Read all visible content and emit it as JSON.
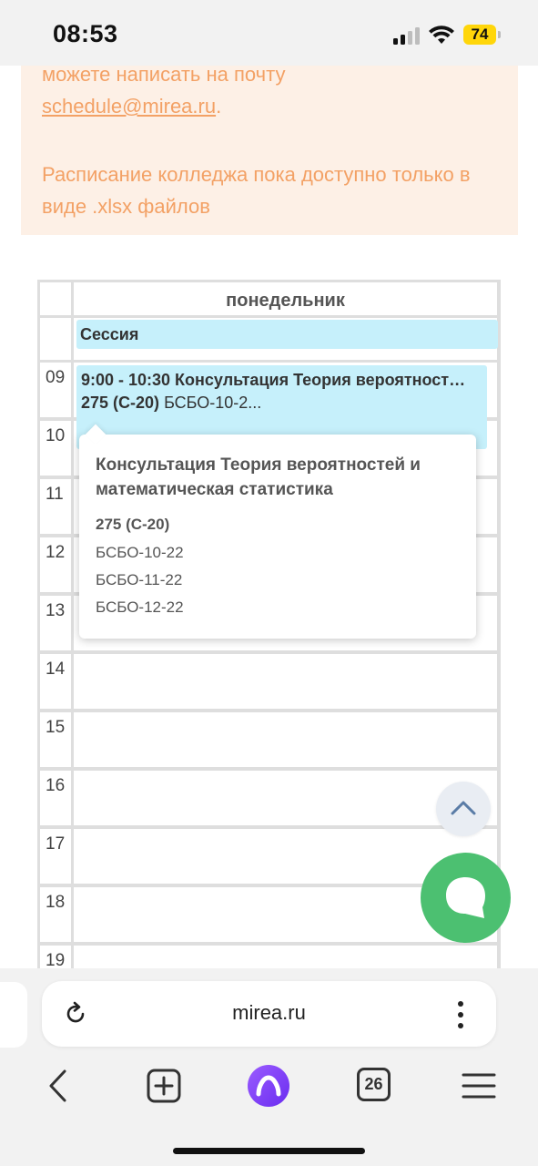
{
  "status_bar": {
    "time": "08:53",
    "battery": "74"
  },
  "notice": {
    "line1_prefix": "можете написать на почту",
    "email": "schedule@mirea.ru",
    "email_suffix": ".",
    "college_note": "Расписание колледжа пока доступно только в виде .xlsx файлов"
  },
  "schedule": {
    "day": "понедельник",
    "all_day_event": "Сессия",
    "hours": [
      "09",
      "10",
      "11",
      "12",
      "13",
      "14",
      "15",
      "16",
      "17",
      "18",
      "19"
    ],
    "event": {
      "line1": "9:00 - 10:30 Консультация Теория вероятност…",
      "room": "275 (С-20)",
      "groups_short": "БСБО-10-2..."
    }
  },
  "popover": {
    "title": "Консультация Теория вероятностей и математическая статистика",
    "room": "275 (С-20)",
    "groups": [
      "БСБО-10-22",
      "БСБО-11-22",
      "БСБО-12-22"
    ]
  },
  "browser": {
    "url": "mirea.ru",
    "tab_count": "26"
  },
  "colors": {
    "event_bg": "#c6f0fb",
    "notice_text": "#f3a165",
    "notice_bg": "#fdf0e6",
    "chat_button": "#4cc071"
  }
}
